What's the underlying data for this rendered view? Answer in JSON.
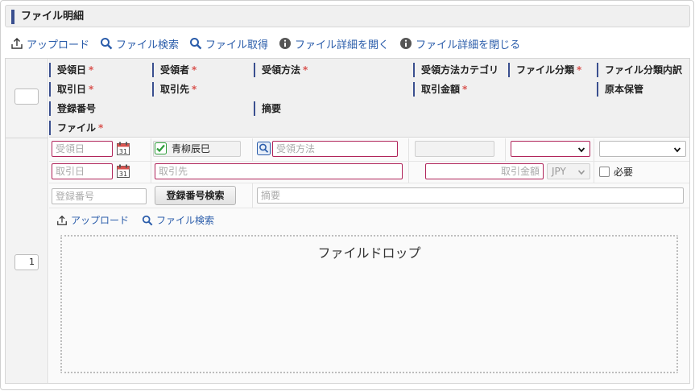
{
  "section": {
    "title": "ファイル明細"
  },
  "toolbar": {
    "upload": "アップロード",
    "file_search": "ファイル検索",
    "file_get": "ファイル取得",
    "detail_open": "ファイル詳細を開く",
    "detail_close": "ファイル詳細を閉じる"
  },
  "header": {
    "received_date": "受領日",
    "receiver": "受領者",
    "receive_method": "受領方法",
    "receive_method_category": "受領方法カテゴリ",
    "file_class": "ファイル分類",
    "file_class_detail": "ファイル分類内訳",
    "transaction_date": "取引日",
    "counterparty": "取引先",
    "transaction_amount": "取引金額",
    "original_storage": "原本保管",
    "registration_number": "登録番号",
    "summary": "摘要",
    "file": "ファイル",
    "required_mark": "*"
  },
  "row": {
    "index": "1",
    "received_date_placeholder": "受領日",
    "calendar_day": "31",
    "receiver_value": "青柳辰巳",
    "receive_method_placeholder": "受領方法",
    "transaction_date_placeholder": "取引日",
    "counterparty_placeholder": "取引先",
    "amount_placeholder": "取引金額",
    "currency": "JPY",
    "required_label": "必要",
    "registration_placeholder": "登録番号",
    "registration_search": "登録番号検索",
    "summary_placeholder": "摘要",
    "upload": "アップロード",
    "file_search": "ファイル検索",
    "drop_text": "ファイルドロップ"
  },
  "colors": {
    "accent": "#2a5caa",
    "required": "#d9534f",
    "field_required_border": "#b0245a",
    "header_bar": "#3a4f8f"
  }
}
